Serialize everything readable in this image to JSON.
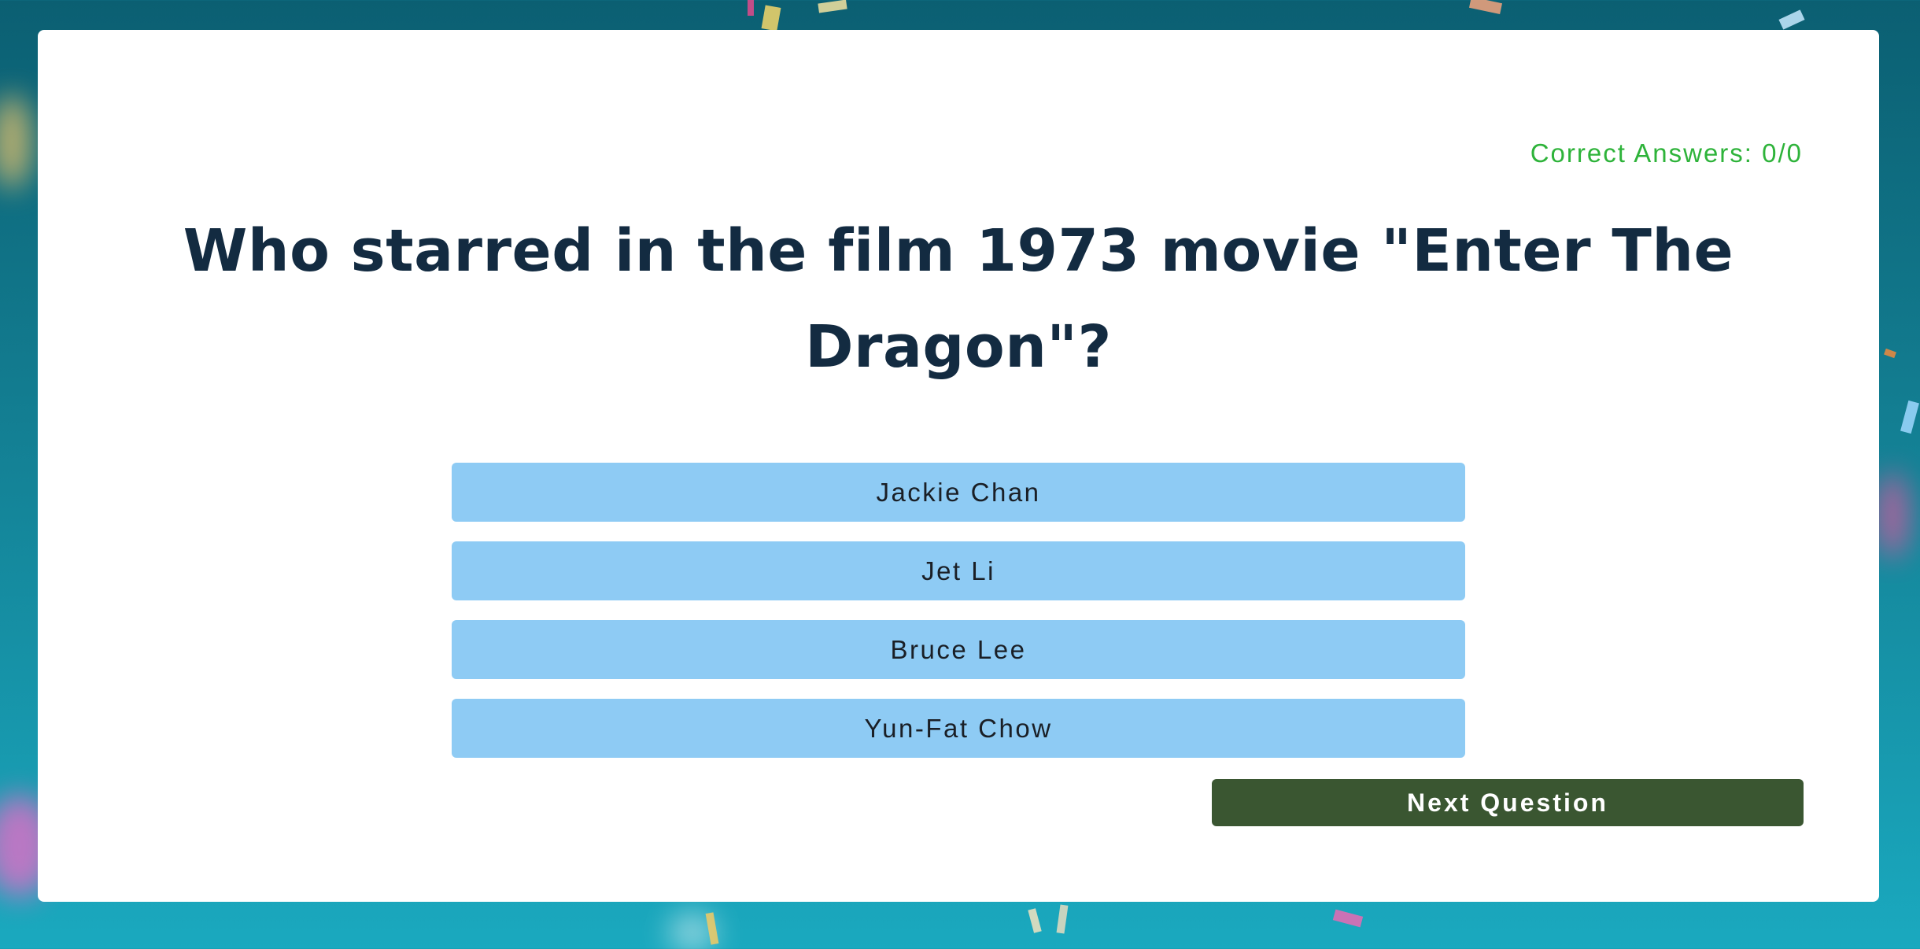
{
  "score": {
    "text": "Correct Answers: 0/0"
  },
  "question": {
    "text": "Who starred in the film 1973 movie \"Enter The Dragon\"?"
  },
  "answers": [
    {
      "label": "Jackie Chan"
    },
    {
      "label": "Jet Li"
    },
    {
      "label": "Bruce Lee"
    },
    {
      "label": "Yun-Fat Chow"
    }
  ],
  "next_button": {
    "label": "Next Question"
  },
  "colors": {
    "background": "#137f93",
    "card": "#ffffff",
    "score_text": "#2eb33a",
    "question_text": "#132b41",
    "answer_button": "#8ecbf4",
    "next_button": "#3a5631"
  }
}
